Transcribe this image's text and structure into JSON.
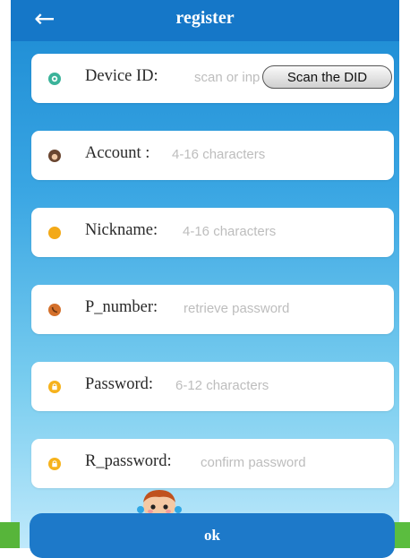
{
  "header": {
    "title": "register",
    "back_icon": "arrow-left-icon"
  },
  "fields": [
    {
      "label": "Device ID:",
      "placeholder": "scan or inp",
      "icon": "target-icon",
      "icon_color": "#3bb39a"
    },
    {
      "label": "Account :",
      "placeholder": "4-16 characters",
      "icon": "person-icon",
      "icon_color": "#6a4630"
    },
    {
      "label": "Nickname:",
      "placeholder": "4-16 characters",
      "icon": "hand-icon",
      "icon_color": "#f3a917"
    },
    {
      "label": "P_number:",
      "placeholder": "retrieve password",
      "icon": "phone-icon",
      "icon_color": "#d4702b"
    },
    {
      "label": "Password:",
      "placeholder": "6-12 characters",
      "icon": "lock-icon",
      "icon_color": "#f6b21c"
    },
    {
      "label": "R_password:",
      "placeholder": "confirm password",
      "icon": "lock-icon",
      "icon_color": "#f6b21c"
    }
  ],
  "scan_button": {
    "label": "Scan the DID"
  },
  "ok_button": {
    "label": "ok"
  },
  "mascot_icon": "kid-mascot-icon"
}
